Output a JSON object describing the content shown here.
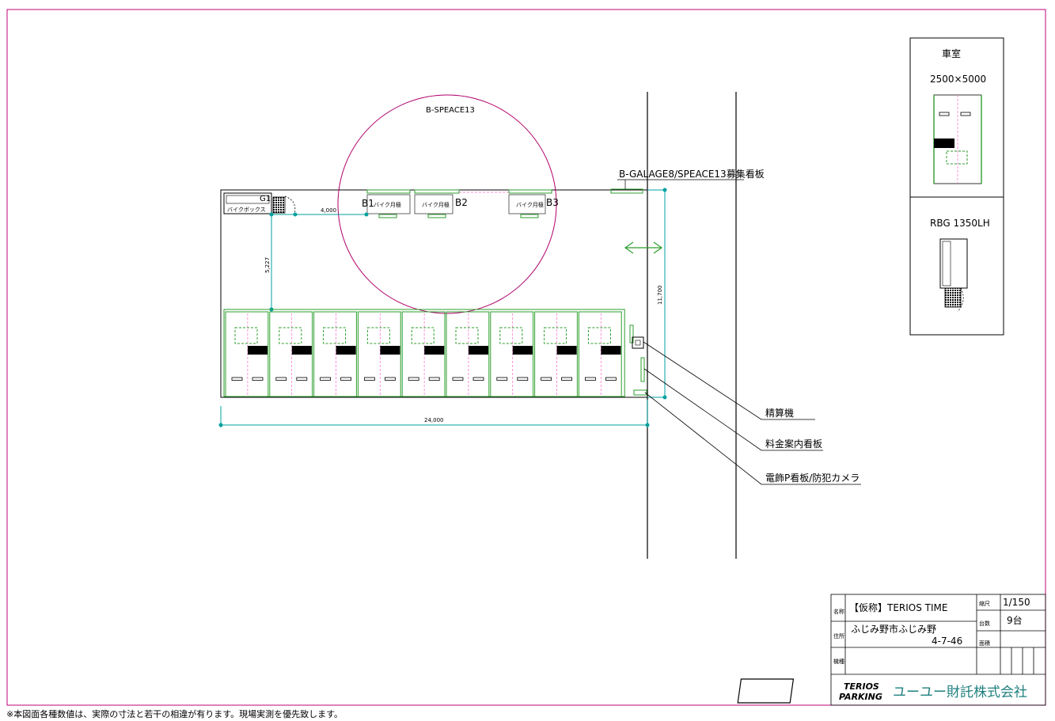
{
  "site": {
    "circle_label": "B-SPEACE13",
    "sign_label": "B-GALAGE8/SPEACE13募集看板",
    "bike_box": "バイクボックス",
    "g1": "G1",
    "bikes": [
      {
        "id": "B1",
        "text": "バイク月極"
      },
      {
        "id": "B2",
        "text": "バイク月極"
      },
      {
        "id": "B3",
        "text": "バイク月極"
      }
    ],
    "dims": {
      "d4000": "4,000",
      "d5227": "5,227",
      "d11700": "11,700",
      "d24000": "24,000"
    },
    "callouts": {
      "pay_machine": "精算機",
      "fee_sign": "料金案内看板",
      "light_sign": "電飾P看板/防犯カメラ"
    }
  },
  "legend": {
    "car_title": "車室",
    "car_size": "2500×5000",
    "bike_title": "RBG 1350LH"
  },
  "title_block": {
    "name_label": "名称",
    "name_value": "【仮称】TERIOS TIME",
    "address_label": "住所",
    "address_value": "ふじみ野市ふじみ野",
    "address_number": "4-7-46",
    "model_label": "機種",
    "scale_label": "縮尺",
    "scale_value": "1/150",
    "count_label": "台数",
    "count_value": "9台",
    "area_label": "面積",
    "logo_line1": "TERIOS",
    "logo_line2": "PARKING",
    "company": "ユーユー財託株式会社"
  },
  "note": "※本図面各種数値は、実際の寸法と若干の相違が有ります。現場実測を優先致します。",
  "colors": {
    "frame": "#c0007a",
    "dim": "#00a0a0",
    "equip": "#2e9e2e",
    "guide": "#ff66cc"
  }
}
